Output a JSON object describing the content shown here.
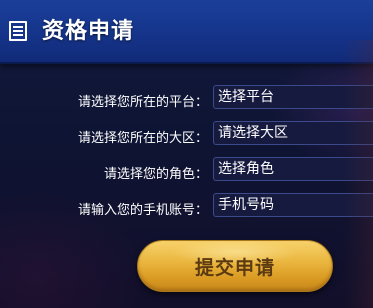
{
  "header": {
    "title": "资格申请",
    "icon": "document-icon"
  },
  "form": {
    "fields": [
      {
        "label": "请选择您所在的平台：",
        "placeholder": "选择平台"
      },
      {
        "label": "请选择您所在的大区：",
        "placeholder": "请选择大区"
      },
      {
        "label": "请选择您的角色：",
        "placeholder": "选择角色"
      },
      {
        "label": "请输入您的手机账号：",
        "placeholder": "手机号码"
      }
    ],
    "submit_label": "提交申请"
  },
  "colors": {
    "header_bg": "#1b3f9a",
    "page_bg": "#0e1433",
    "button_gold": "#e9b43c",
    "button_text": "#5b3a12"
  }
}
